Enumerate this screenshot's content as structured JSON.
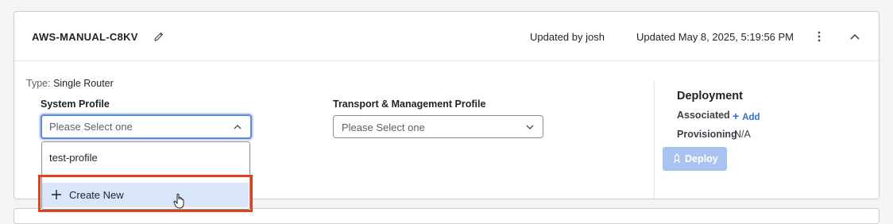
{
  "header": {
    "title": "AWS-MANUAL-C8KV",
    "updated_by": "Updated by josh",
    "updated_at": "Updated May 8, 2025, 5:19:56 PM"
  },
  "details": {
    "type_key": "Type:",
    "type_value": "Single Router",
    "system_profile": {
      "label": "System Profile",
      "placeholder": "Please Select one",
      "options": [
        "test-profile"
      ],
      "create_new": "Create New"
    },
    "transport_profile": {
      "label": "Transport & Management Profile",
      "placeholder": "Please Select one"
    }
  },
  "deployment": {
    "title": "Deployment",
    "associated_label": "Associated",
    "add_label": "Add",
    "provisioning_label": "Provisioning",
    "provisioning_value": "N/A",
    "deploy_label": "Deploy"
  },
  "colors": {
    "accent": "#2f6fd0",
    "highlight": "#e0411b",
    "selected_option": "#d9e5fb",
    "deploy_disabled": "#a9c3ef"
  }
}
